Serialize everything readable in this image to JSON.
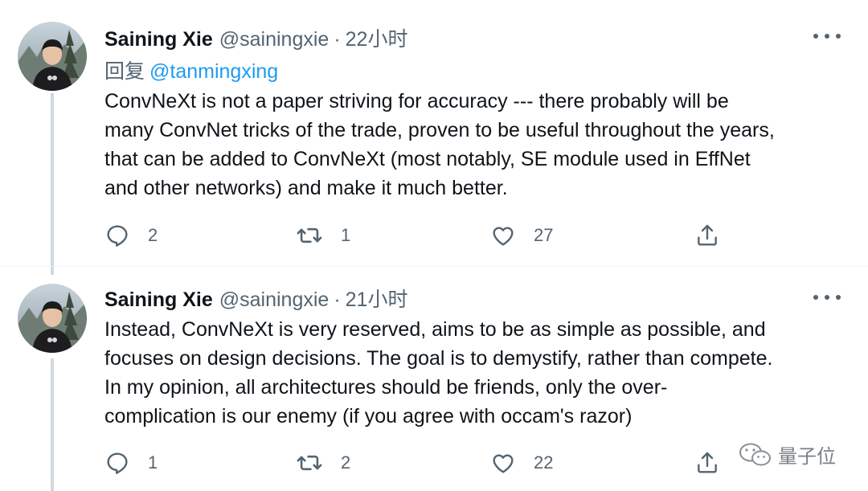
{
  "tweets": [
    {
      "name": "Saining Xie",
      "handle": "@sainingxie",
      "separator": "·",
      "time": "22小时",
      "reply_label": "回复",
      "reply_mention": "@tanmingxing",
      "text": "ConvNeXt is not a paper striving for accuracy --- there probably will be\nmany ConvNet tricks of the trade, proven to be useful throughout the years,\nthat can be added to ConvNeXt (most notably, SE module used in EffNet\nand other networks) and make it much better.",
      "replies": "2",
      "retweets": "1",
      "likes": "27"
    },
    {
      "name": "Saining Xie",
      "handle": "@sainingxie",
      "separator": "·",
      "time": "21小时",
      "text": "Instead, ConvNeXt is very reserved, aims to be as simple as possible, and\nfocuses on design decisions. The goal is to demystify, rather than compete.\nIn my opinion, all architectures should be friends, only the over-\ncomplication is our enemy (if you agree with occam's razor)",
      "replies": "1",
      "retweets": "2",
      "likes": "22"
    }
  ],
  "watermark": {
    "text": "量子位",
    "icon": "wechat-icon"
  },
  "icons": {
    "reply": "reply-icon",
    "retweet": "retweet-icon",
    "like": "heart-icon",
    "share": "share-icon",
    "more": "more-icon"
  },
  "colors": {
    "mention": "#1d9bf0",
    "secondary_text": "#536471",
    "thread_line": "#cfd9de"
  }
}
